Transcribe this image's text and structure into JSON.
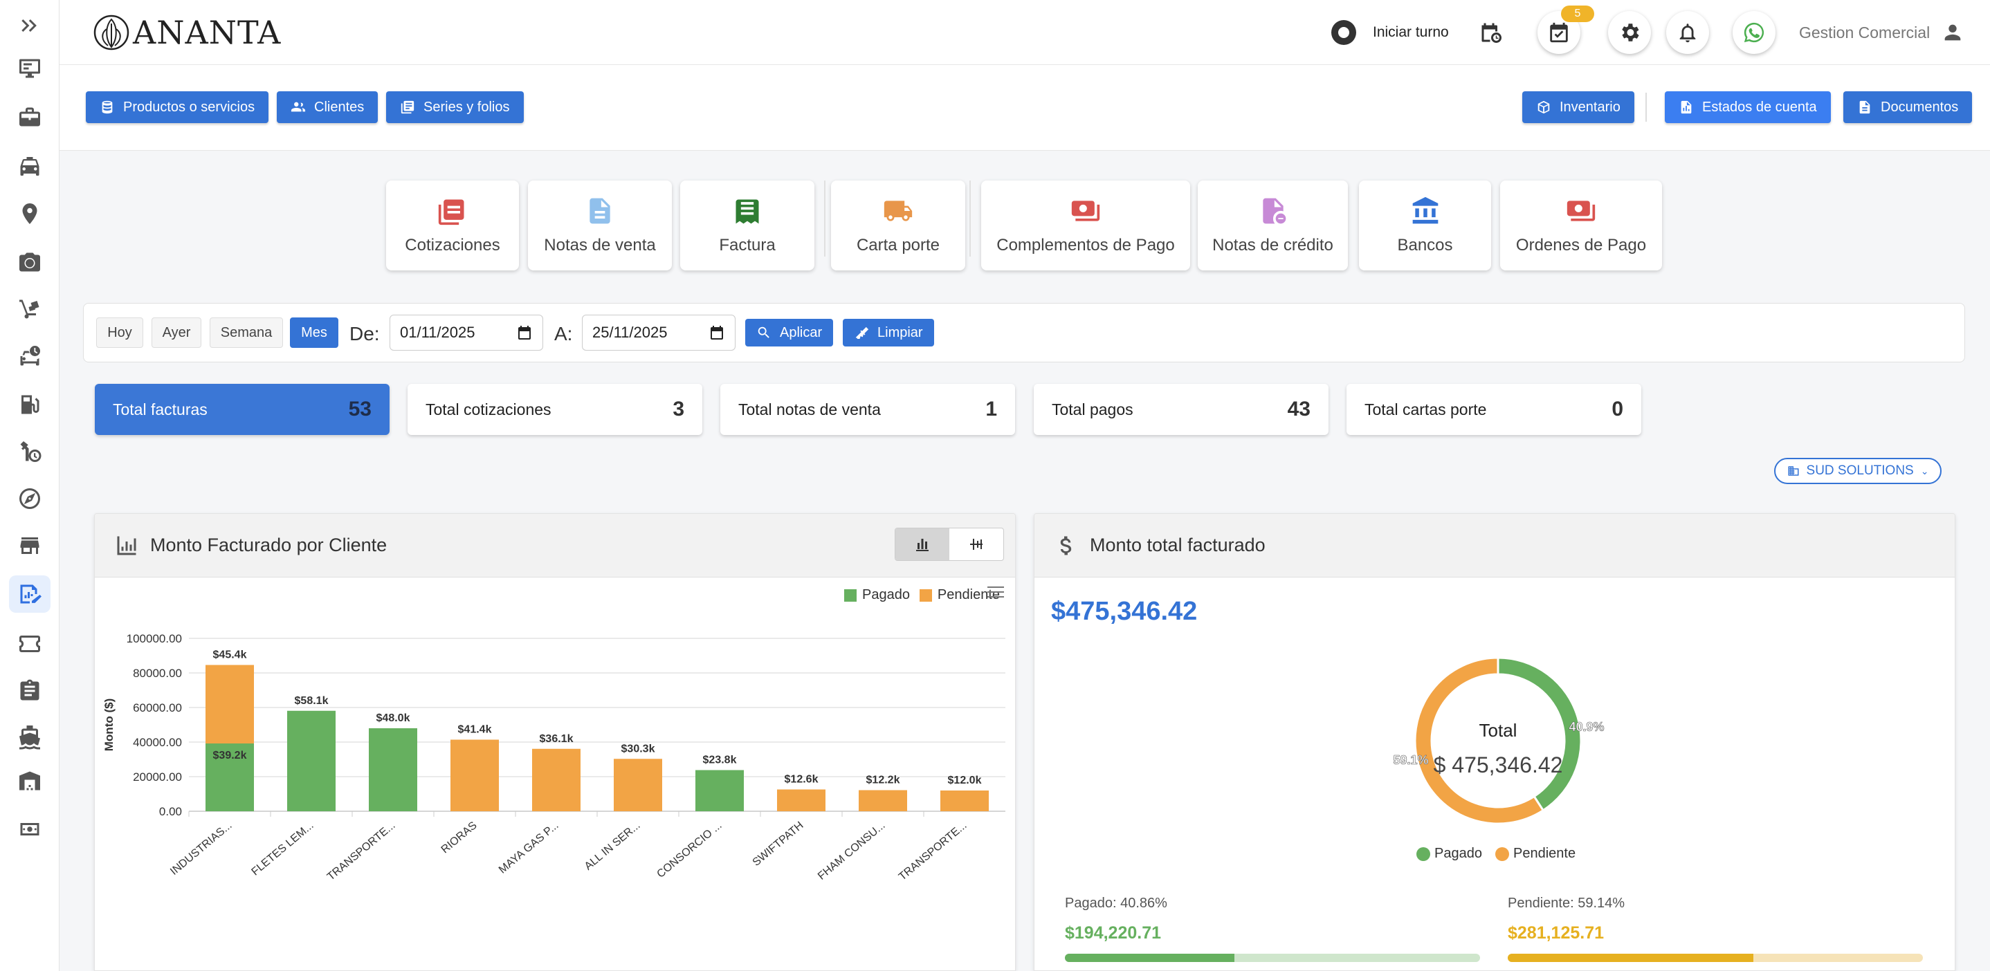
{
  "app": {
    "logo_text": "ANANTA"
  },
  "topbar": {
    "shift_label": "Iniciar turno",
    "tasks_badge": "5",
    "user_label": "Gestion Comercial"
  },
  "sidebar": {
    "items": [
      {
        "icon": "chevron-double-right-icon"
      },
      {
        "icon": "monitor-icon"
      },
      {
        "icon": "briefcase-icon"
      },
      {
        "icon": "taxi-icon"
      },
      {
        "icon": "location-pin-icon"
      },
      {
        "icon": "camera-icon"
      },
      {
        "icon": "hand-truck-icon"
      },
      {
        "icon": "car-clock-icon"
      },
      {
        "icon": "fuel-icon"
      },
      {
        "icon": "wrench-clock-icon"
      },
      {
        "icon": "compass-icon"
      },
      {
        "icon": "store-icon"
      },
      {
        "icon": "sales-chart-icon",
        "active": true
      },
      {
        "icon": "ticket-icon"
      },
      {
        "icon": "clipboard-icon"
      },
      {
        "icon": "ship-icon"
      },
      {
        "icon": "warehouse-icon"
      },
      {
        "icon": "cash-icon"
      }
    ]
  },
  "toolbar": {
    "products": "Productos o servicios",
    "clients": "Clientes",
    "series": "Series y folios",
    "inventory": "Inventario",
    "statements": "Estados de cuenta",
    "documents": "Documentos"
  },
  "modules": [
    {
      "label": "Cotizaciones",
      "icon": "receipt-list-icon",
      "color": "#d9534f"
    },
    {
      "label": "Notas de venta",
      "icon": "document-icon",
      "color": "#90c0ec"
    },
    {
      "label": "Factura",
      "icon": "invoice-icon",
      "color": "#2e7d32"
    },
    {
      "label": "Carta porte",
      "icon": "truck-icon",
      "color": "#e8964a"
    },
    {
      "label": "Complementos de Pago",
      "icon": "payment-icon",
      "color": "#d9534f"
    },
    {
      "label": "Notas de crédito",
      "icon": "credit-note-icon",
      "color": "#c78ad6"
    },
    {
      "label": "Bancos",
      "icon": "bank-icon",
      "color": "#3473d5"
    },
    {
      "label": "Ordenes de Pago",
      "icon": "payment-order-icon",
      "color": "#d9534f"
    }
  ],
  "filter": {
    "today": "Hoy",
    "yesterday": "Ayer",
    "week": "Semana",
    "month": "Mes",
    "from_label": "De:",
    "from_value": "01/11/2025",
    "to_label": "A:",
    "to_value": "25/11/2025",
    "apply": "Aplicar",
    "clear": "Limpiar"
  },
  "stats": [
    {
      "label": "Total facturas",
      "value": "53",
      "active": true
    },
    {
      "label": "Total cotizaciones",
      "value": "3"
    },
    {
      "label": "Total notas de venta",
      "value": "1"
    },
    {
      "label": "Total pagos",
      "value": "43"
    },
    {
      "label": "Total cartas porte",
      "value": "0"
    }
  ],
  "company_selector": "SUD SOLUTIONS",
  "bar_panel": {
    "title": "Monto Facturado por Cliente"
  },
  "donut_panel": {
    "title": "Monto total facturado",
    "total": "$475,346.42",
    "center_label": "Total",
    "center_value": "$ 475,346.42",
    "paid_pct_label": "40.9%",
    "pending_pct_label": "59.1%",
    "paid_label": "Pagado: 40.86%",
    "paid_value": "$194,220.71",
    "pending_label": "Pendiente: 59.14%",
    "pending_value": "$281,125.71",
    "legend": [
      "Pagado",
      "Pendiente"
    ]
  },
  "colors": {
    "primary": "#3473d5",
    "paid": "#66b05f",
    "pending": "#f2a445"
  },
  "chart_data": [
    {
      "type": "bar",
      "title": "",
      "xlabel": "",
      "ylabel": "Monto ($)",
      "ylim": [
        0,
        100000
      ],
      "yticks": [
        "0.00",
        "20000.00",
        "40000.00",
        "60000.00",
        "80000.00",
        "100000.00"
      ],
      "legend_position": "top-right",
      "categories": [
        "INDUSTRIAS...",
        "FLETES LEM...",
        "TRANSPORTE...",
        "RIORAS",
        "MAYA GAS P...",
        "ALL IN SER...",
        "CONSORCIO ...",
        "SWIFTPATH",
        "FHAM CONSU...",
        "TRANSPORTE..."
      ],
      "series": [
        {
          "name": "Pagado",
          "color": "#66b05f",
          "values": [
            39200,
            58100,
            48000,
            0,
            0,
            0,
            23800,
            0,
            0,
            0
          ]
        },
        {
          "name": "Pendiente",
          "color": "#f2a445",
          "values": [
            45400,
            0,
            0,
            41400,
            36100,
            30300,
            0,
            12600,
            12200,
            12000
          ]
        }
      ],
      "data_labels": [
        {
          "category": 0,
          "series": "Pendiente",
          "text": "$45.4k"
        },
        {
          "category": 0,
          "series": "Pagado",
          "text": "$39.2k"
        },
        {
          "category": 1,
          "series": "Pagado",
          "text": "$58.1k"
        },
        {
          "category": 2,
          "series": "Pagado",
          "text": "$48.0k"
        },
        {
          "category": 3,
          "series": "Pendiente",
          "text": "$41.4k"
        },
        {
          "category": 4,
          "series": "Pendiente",
          "text": "$36.1k"
        },
        {
          "category": 5,
          "series": "Pendiente",
          "text": "$30.3k"
        },
        {
          "category": 6,
          "series": "Pagado",
          "text": "$23.8k"
        },
        {
          "category": 7,
          "series": "Pendiente",
          "text": "$12.6k"
        },
        {
          "category": 8,
          "series": "Pendiente",
          "text": "$12.2k"
        },
        {
          "category": 9,
          "series": "Pendiente",
          "text": "$12.0k"
        }
      ]
    },
    {
      "type": "pie",
      "title": "",
      "categories": [
        "Pagado",
        "Pendiente"
      ],
      "values": [
        194220.71,
        281125.71
      ],
      "colors": [
        "#66b05f",
        "#f2a445"
      ],
      "donut": true,
      "legend_position": "bottom"
    }
  ]
}
